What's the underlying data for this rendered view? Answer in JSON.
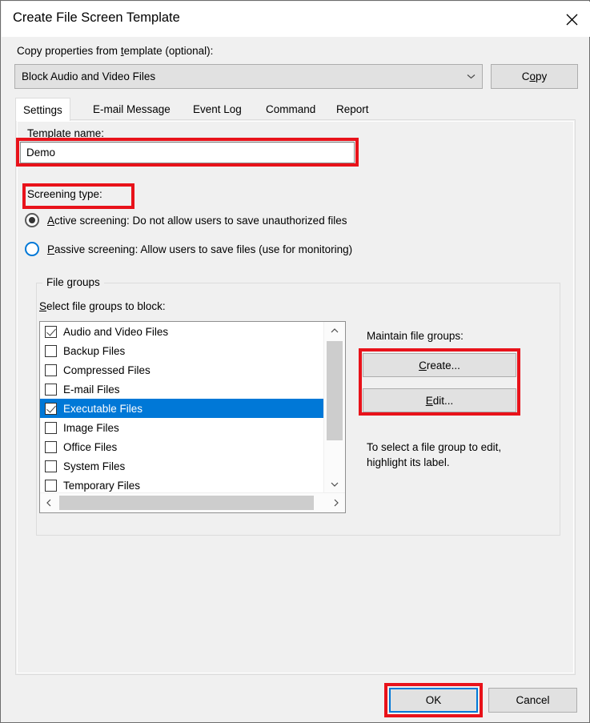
{
  "window": {
    "title": "Create File Screen Template",
    "close_icon": "close-icon"
  },
  "copy_section": {
    "label_prefix": "Copy properties from ",
    "label_accel": "t",
    "label_suffix": "emplate (optional):",
    "selected_template": "Block Audio and Video Files",
    "dropdown_icon": "chevron-down-icon",
    "copy_button": {
      "prefix": "C",
      "accel": "o",
      "suffix": "py"
    }
  },
  "tabs": [
    {
      "label": "Settings",
      "active": true
    },
    {
      "label": "E-mail Message",
      "active": false
    },
    {
      "label": "Event Log",
      "active": false
    },
    {
      "label": "Command",
      "active": false
    },
    {
      "label": "Report",
      "active": false
    }
  ],
  "settings": {
    "template_name_label": "Template name:",
    "template_name_value": "Demo",
    "screening_type_label": "Screening type:",
    "radios": [
      {
        "accel": "A",
        "text": "ctive screening: Do not allow users to save unauthorized files",
        "checked": true
      },
      {
        "accel": "P",
        "text": "assive screening: Allow users to save files (use for monitoring)",
        "checked": false
      }
    ],
    "file_groups": {
      "groupbox_title": "File groups",
      "select_label_accel": "S",
      "select_label_rest": "elect file groups to block:",
      "items": [
        {
          "label": "Audio and Video Files",
          "checked": true,
          "selected": false
        },
        {
          "label": "Backup Files",
          "checked": false,
          "selected": false
        },
        {
          "label": "Compressed Files",
          "checked": false,
          "selected": false
        },
        {
          "label": "E-mail Files",
          "checked": false,
          "selected": false
        },
        {
          "label": "Executable Files",
          "checked": true,
          "selected": true
        },
        {
          "label": "Image Files",
          "checked": false,
          "selected": false
        },
        {
          "label": "Office Files",
          "checked": false,
          "selected": false
        },
        {
          "label": "System Files",
          "checked": false,
          "selected": false
        },
        {
          "label": "Temporary Files",
          "checked": false,
          "selected": false
        }
      ],
      "scroll_up_icon": "chevron-up-icon",
      "scroll_down_icon": "chevron-down-icon",
      "scroll_left_icon": "chevron-left-icon",
      "scroll_right_icon": "chevron-right-icon"
    },
    "maintain": {
      "label_prefix": "Maintain file ",
      "label_accel": "g",
      "label_suffix": "roups:",
      "create_button": {
        "accel": "C",
        "rest": "reate..."
      },
      "edit_button": {
        "accel": "E",
        "rest": "dit..."
      },
      "hint": "To select a file group to edit, highlight its label."
    }
  },
  "footer": {
    "ok_label": "OK",
    "cancel_label": "Cancel"
  },
  "colors": {
    "accent_blue": "#0078d7",
    "annotation_red": "#e8121a",
    "dialog_background": "#f0f0f0",
    "button_face": "#e1e1e1"
  }
}
